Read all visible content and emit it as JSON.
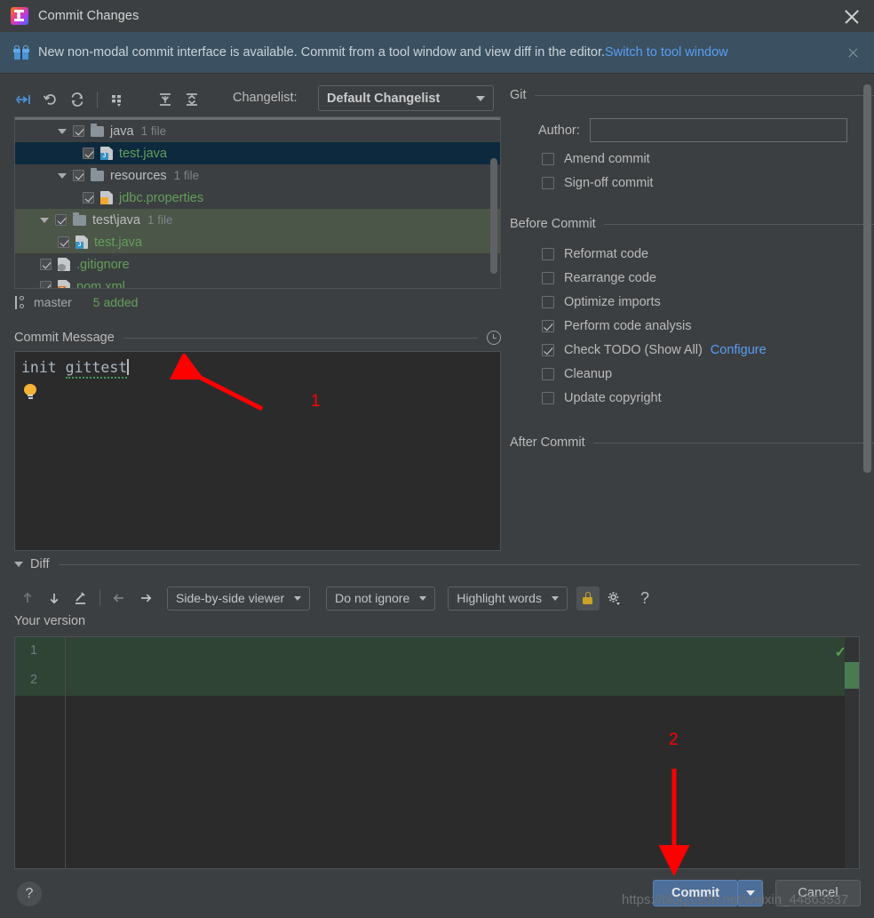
{
  "window": {
    "title": "Commit Changes",
    "logo_icon": "intellij-idea-logo",
    "close_icon": "close-icon"
  },
  "notification": {
    "icon": "gift-icon",
    "text": "New non-modal commit interface is available. Commit from a tool window and view diff in the editor.",
    "link": "Switch to tool window",
    "close_icon": "close-icon",
    "link_color": "#589df6",
    "bg_color": "#3b5161"
  },
  "toolbar": {
    "buttons": [
      {
        "name": "show-diff-icon",
        "title": "Show Diff"
      },
      {
        "name": "rollback-icon",
        "title": "Rollback"
      },
      {
        "name": "refresh-icon",
        "title": "Refresh"
      },
      {
        "name": "group-by-icon",
        "title": "Group By"
      },
      {
        "name": "expand-all-icon",
        "title": "Expand All"
      },
      {
        "name": "collapse-all-icon",
        "title": "Collapse All"
      }
    ],
    "changelist_label": "Changelist:",
    "changelist_value": "Default Changelist"
  },
  "file_tree": {
    "rows": [
      {
        "indent": 1,
        "twisty": true,
        "checked": true,
        "icon": "folder-icon",
        "name": "java",
        "name_color": "grey",
        "meta": "1 file",
        "state": "normal"
      },
      {
        "indent": 2,
        "twisty": false,
        "checked": true,
        "icon": "java-file-icon",
        "name": "test.java",
        "name_color": "green",
        "meta": "",
        "state": "selected"
      },
      {
        "indent": 1,
        "twisty": true,
        "checked": true,
        "icon": "folder-icon",
        "name": "resources",
        "name_color": "grey",
        "meta": "1 file",
        "state": "normal"
      },
      {
        "indent": 2,
        "twisty": false,
        "checked": true,
        "icon": "properties-file-icon",
        "name": "jdbc.properties",
        "name_color": "green",
        "meta": "",
        "state": "normal"
      },
      {
        "indent": 0,
        "twisty": true,
        "checked": true,
        "icon": "folder-icon",
        "name": "test\\java",
        "name_color": "grey",
        "meta": "1 file",
        "state": "highlighted"
      },
      {
        "indent": 1,
        "twisty": false,
        "checked": true,
        "icon": "java-file-icon",
        "name": "test.java",
        "name_color": "green",
        "meta": "",
        "state": "highlighted"
      },
      {
        "indent": 0,
        "twisty": false,
        "checked": true,
        "icon": "gitignore-file-icon",
        "name": ".gitignore",
        "name_color": "green",
        "meta": "",
        "state": "normal"
      },
      {
        "indent": 0,
        "twisty": false,
        "checked": true,
        "icon": "xml-file-icon",
        "name": "pom.xml",
        "name_color": "green",
        "meta": "",
        "state": "normal"
      }
    ]
  },
  "branch_status": {
    "icon": "branch-icon",
    "branch": "master",
    "added": "5 added",
    "added_color": "#62a05a"
  },
  "commit_message": {
    "section_label": "Commit Message",
    "history_icon": "clock-history-icon",
    "value_plain": "init ",
    "value_misspelled": "gittest",
    "bulb_icon": "lightbulb-intention-icon"
  },
  "right_panel": {
    "git_section": {
      "title": "Git",
      "author_label": "Author:",
      "author_value": "",
      "author_placeholder": "",
      "checkboxes": [
        {
          "label": "Amend commit",
          "checked": false
        },
        {
          "label": "Sign-off commit",
          "checked": false
        }
      ]
    },
    "before_commit_section": {
      "title": "Before Commit",
      "checkboxes": [
        {
          "label": "Reformat code",
          "checked": false,
          "link": ""
        },
        {
          "label": "Rearrange code",
          "checked": false,
          "link": ""
        },
        {
          "label": "Optimize imports",
          "checked": false,
          "link": ""
        },
        {
          "label": "Perform code analysis",
          "checked": true,
          "link": ""
        },
        {
          "label": "Check TODO (Show All)",
          "checked": true,
          "link": "Configure"
        },
        {
          "label": "Cleanup",
          "checked": false,
          "link": ""
        },
        {
          "label": "Update copyright",
          "checked": false,
          "link": ""
        }
      ]
    },
    "after_commit_section": {
      "title": "After Commit"
    }
  },
  "diff": {
    "section_label": "Diff",
    "toolbar": {
      "prev_diff_icon": "arrow-up-icon",
      "next_diff_icon": "arrow-down-icon",
      "edit_icon": "pencil-edit-icon",
      "prev_change_icon": "arrow-left-icon",
      "next_change_icon": "arrow-right-icon",
      "viewer_mode": "Side-by-side viewer",
      "whitespace_mode": "Do not ignore",
      "highlight_mode": "Highlight words",
      "lock_icon": "lock-icon",
      "settings_icon": "gear-icon",
      "help_icon": "question-mark-icon"
    },
    "pane_title": "Your version",
    "line_numbers": [
      "1",
      "2"
    ],
    "status_check_icon": "green-check-icon"
  },
  "bottom": {
    "help_icon": "question-mark-icon",
    "commit_label": "Commit",
    "commit_dropdown_icon": "chevron-down-icon",
    "cancel_label": "Cancel",
    "commit_color": "#4c6e99"
  },
  "annotations": {
    "marker_1": "1",
    "marker_2": "2",
    "color": "#ff0000"
  },
  "watermark": {
    "text": "https://blog.csdn.net/weixin_44863537"
  }
}
